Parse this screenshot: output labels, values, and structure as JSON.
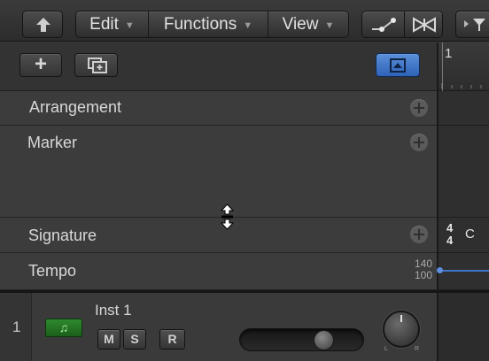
{
  "toolbar": {
    "menus": [
      {
        "label": "Edit"
      },
      {
        "label": "Functions"
      },
      {
        "label": "View"
      }
    ],
    "icons": [
      "up-arrow-icon",
      "automation-icon",
      "flex-icon",
      "filter-icon"
    ]
  },
  "global_tracks": {
    "rows": [
      {
        "label": "Arrangement"
      },
      {
        "label": "Marker"
      },
      {
        "label": "Signature"
      },
      {
        "label": "Tempo"
      }
    ],
    "tempo_scale": {
      "max": "140",
      "min": "100"
    }
  },
  "ruler": {
    "bar": "1"
  },
  "signature": {
    "numerator": "4",
    "denominator": "4",
    "key": "C"
  },
  "track": {
    "number": "1",
    "name": "Inst 1",
    "buttons": {
      "mute": "M",
      "solo": "S",
      "record": "R"
    },
    "pan_labels": {
      "left": "L",
      "right": "R"
    },
    "volume_fraction": 0.72,
    "instrument_color": "#2e8a2e"
  },
  "colors": {
    "accent_blue": "#3e74c9",
    "selected_button": "#4a7fd0"
  }
}
